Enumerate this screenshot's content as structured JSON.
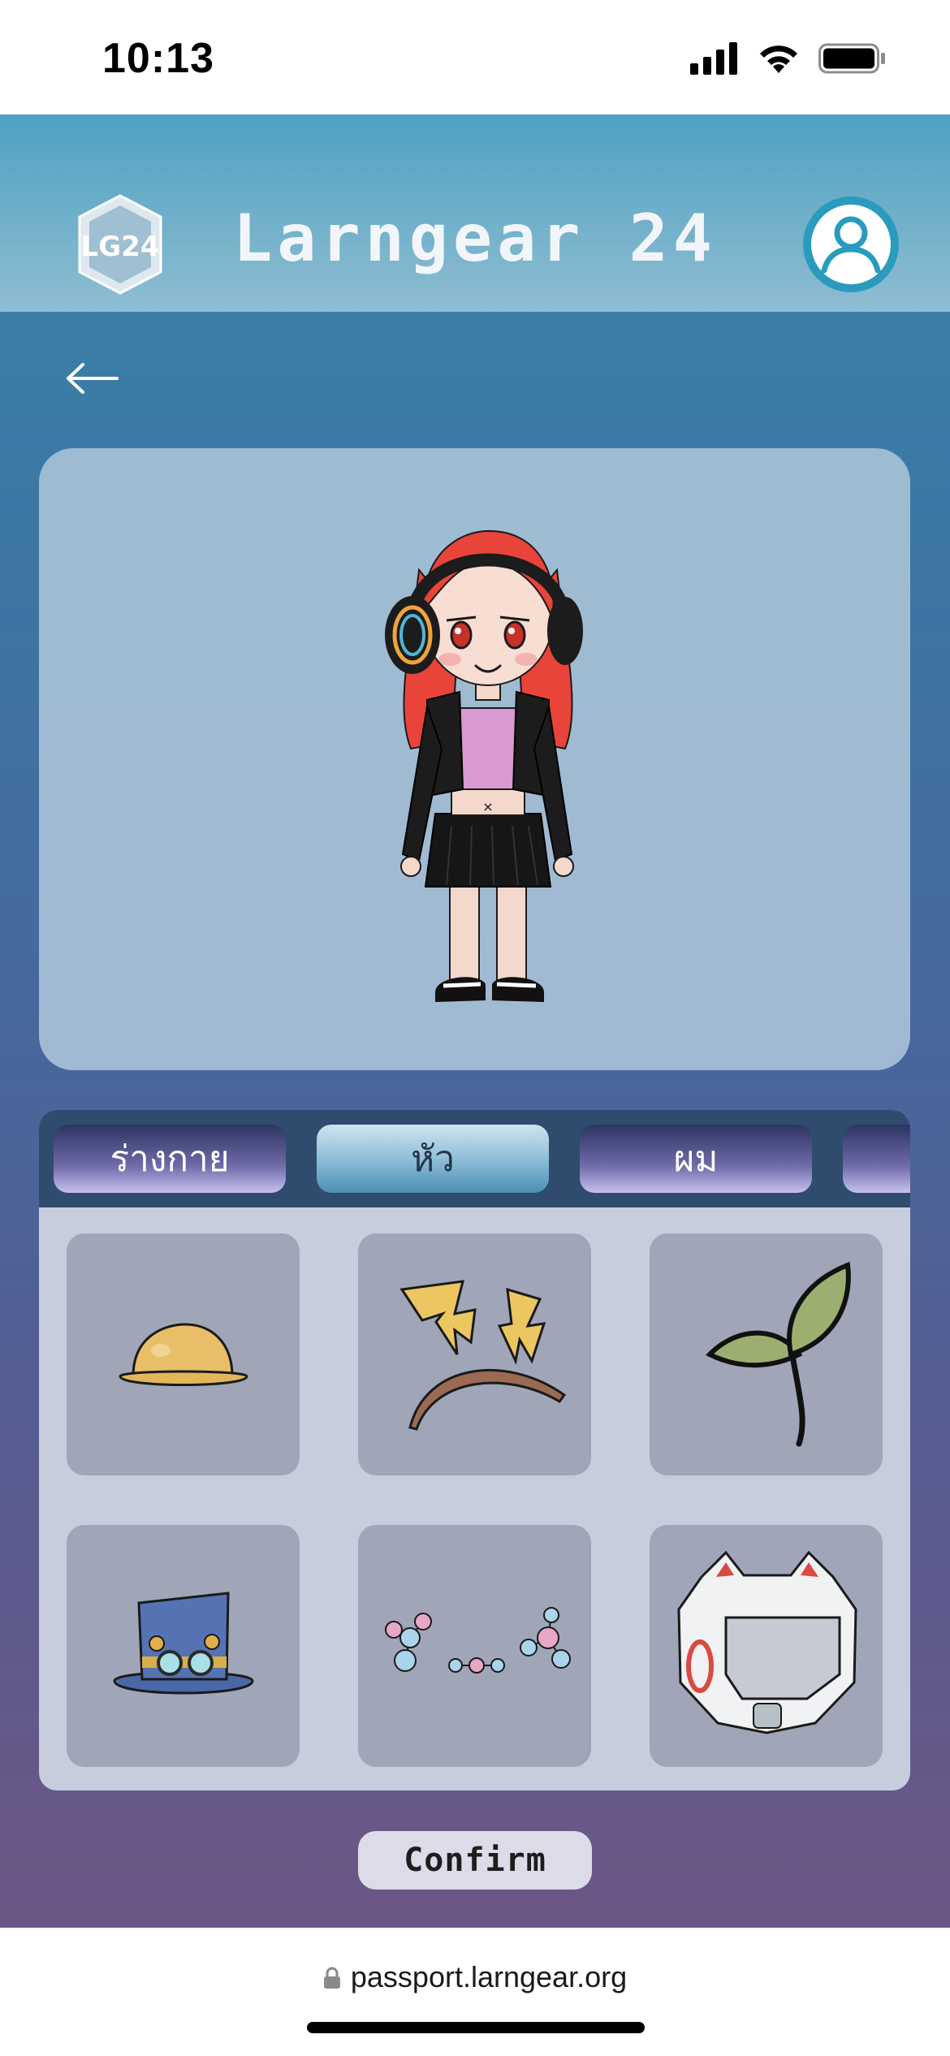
{
  "status_bar": {
    "time": "10:13"
  },
  "header": {
    "title": "Larngear 24",
    "logo_label": "LG24"
  },
  "tabs": [
    {
      "label": "ร่างกาย",
      "active": false
    },
    {
      "label": "หัว",
      "active": true
    },
    {
      "label": "ผม",
      "active": false
    }
  ],
  "items": [
    {
      "icon": "yellow-helmet-icon"
    },
    {
      "icon": "lightning-headband-icon"
    },
    {
      "icon": "sprout-icon"
    },
    {
      "icon": "steampunk-top-hat-icon"
    },
    {
      "icon": "molecule-headband-icon"
    },
    {
      "icon": "robot-helmet-icon"
    }
  ],
  "confirm_label": "Confirm",
  "url_bar": {
    "url": "passport.larngear.org"
  },
  "colors": {
    "header": "#4ea1c2",
    "tab_bar": "#2f4b6e",
    "item_tile": "#a0a6b8",
    "accent_teal": "#2a9bbd"
  }
}
